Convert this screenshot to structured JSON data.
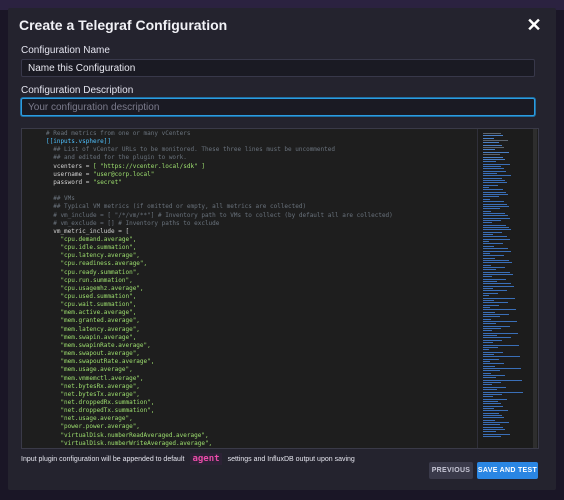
{
  "dialog": {
    "title": "Create a Telegraf Configuration",
    "close_icon": "close-icon"
  },
  "form": {
    "name_label": "Configuration Name",
    "name_value": "Name this Configuration",
    "description_label": "Configuration Description",
    "description_placeholder": "Your configuration description"
  },
  "editor": {
    "lines": [
      {
        "n": "1",
        "text": "# Read metrics from one or many vCenters",
        "kind": "comment"
      },
      {
        "n": "2",
        "text": "[[inputs.vsphere]]",
        "kind": "section"
      },
      {
        "n": "3",
        "text": "  ## List of vCenter URLs to be monitored. These three lines must be uncommented",
        "kind": "comment"
      },
      {
        "n": "4",
        "text": "  ## and edited for the plugin to work.",
        "kind": "comment"
      },
      {
        "n": "5",
        "text": "  vcenters = [ \"https://vcenter.local/sdk\" ]",
        "kind": "assign"
      },
      {
        "n": "6",
        "text": "  username = \"user@corp.local\"",
        "kind": "assign"
      },
      {
        "n": "7",
        "text": "  password = \"secret\"",
        "kind": "assign"
      },
      {
        "n": "8",
        "text": "",
        "kind": "plain"
      },
      {
        "n": "9",
        "text": "  ## VMs",
        "kind": "comment"
      },
      {
        "n": "10",
        "text": "  ## Typical VM metrics (if omitted or empty, all metrics are collected)",
        "kind": "comment"
      },
      {
        "n": "11",
        "text": "  # vm_include = [ \"/*/vm/**\"] # Inventory path to VMs to collect (by default all are collected)",
        "kind": "comment"
      },
      {
        "n": "12",
        "text": "  # vm_exclude = [] # Inventory paths to exclude",
        "kind": "comment"
      },
      {
        "n": "13",
        "text": "  vm_metric_include = [",
        "kind": "plain"
      },
      {
        "n": "14",
        "text": "    \"cpu.demand.average\",",
        "kind": "string"
      },
      {
        "n": "15",
        "text": "    \"cpu.idle.summation\",",
        "kind": "string"
      },
      {
        "n": "16",
        "text": "    \"cpu.latency.average\",",
        "kind": "string"
      },
      {
        "n": "17",
        "text": "    \"cpu.readiness.average\",",
        "kind": "string"
      },
      {
        "n": "18",
        "text": "    \"cpu.ready.summation\",",
        "kind": "string"
      },
      {
        "n": "19",
        "text": "    \"cpu.run.summation\",",
        "kind": "string"
      },
      {
        "n": "20",
        "text": "    \"cpu.usagemhz.average\",",
        "kind": "string"
      },
      {
        "n": "21",
        "text": "    \"cpu.used.summation\",",
        "kind": "string"
      },
      {
        "n": "22",
        "text": "    \"cpu.wait.summation\",",
        "kind": "string"
      },
      {
        "n": "23",
        "text": "    \"mem.active.average\",",
        "kind": "string"
      },
      {
        "n": "24",
        "text": "    \"mem.granted.average\",",
        "kind": "string"
      },
      {
        "n": "25",
        "text": "    \"mem.latency.average\",",
        "kind": "string"
      },
      {
        "n": "26",
        "text": "    \"mem.swapin.average\",",
        "kind": "string"
      },
      {
        "n": "27",
        "text": "    \"mem.swapinRate.average\",",
        "kind": "string"
      },
      {
        "n": "28",
        "text": "    \"mem.swapout.average\",",
        "kind": "string"
      },
      {
        "n": "29",
        "text": "    \"mem.swapoutRate.average\",",
        "kind": "string"
      },
      {
        "n": "30",
        "text": "    \"mem.usage.average\",",
        "kind": "string"
      },
      {
        "n": "31",
        "text": "    \"mem.vmmemctl.average\",",
        "kind": "string"
      },
      {
        "n": "32",
        "text": "    \"net.bytesRx.average\",",
        "kind": "string"
      },
      {
        "n": "33",
        "text": "    \"net.bytesTx.average\",",
        "kind": "string"
      },
      {
        "n": "34",
        "text": "    \"net.droppedRx.summation\",",
        "kind": "string"
      },
      {
        "n": "35",
        "text": "    \"net.droppedTx.summation\",",
        "kind": "string"
      },
      {
        "n": "36",
        "text": "    \"net.usage.average\",",
        "kind": "string"
      },
      {
        "n": "37",
        "text": "    \"power.power.average\",",
        "kind": "string"
      },
      {
        "n": "38",
        "text": "    \"virtualDisk.numberReadAveraged.average\",",
        "kind": "string"
      },
      {
        "n": "39",
        "text": "    \"virtualDisk.numberWriteAveraged.average\",",
        "kind": "string"
      }
    ],
    "colors": {
      "comment": "#6a737d",
      "section": "#4fc1ff",
      "string": "#9ee06f",
      "plain": "#d4d4d4",
      "key": "#d4d4d4"
    }
  },
  "footer": {
    "note_before": "Input plugin configuration will be appended to default",
    "note_agent": "agent",
    "note_after": "settings and InfluxDB output upon saving",
    "previous_label": "PREVIOUS",
    "save_label": "SAVE AND TEST"
  }
}
